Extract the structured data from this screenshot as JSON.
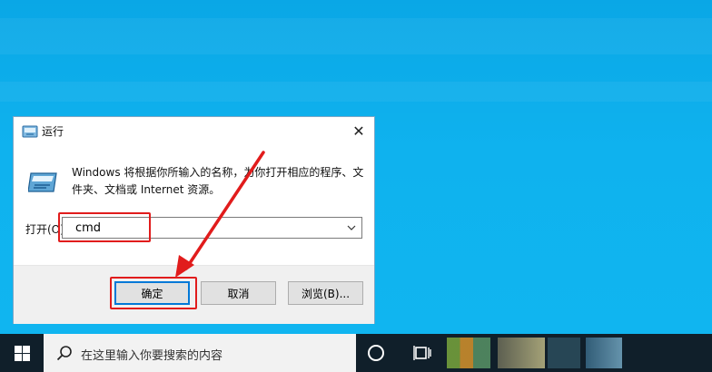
{
  "dialog": {
    "title": "运行",
    "description": "Windows 将根据你所输入的名称，为你打开相应的程序、文件夹、文档或 Internet 资源。",
    "open_label": "打开(O):",
    "command_value": "cmd",
    "buttons": {
      "ok": "确定",
      "cancel": "取消",
      "browse": "浏览(B)..."
    }
  },
  "taskbar": {
    "search_placeholder": "在这里输入你要搜索的内容"
  },
  "colors": {
    "annotation": "#e11c1c",
    "desktop": "#0fb2ee",
    "taskbar": "#101f2a",
    "focus": "#0078d7"
  }
}
